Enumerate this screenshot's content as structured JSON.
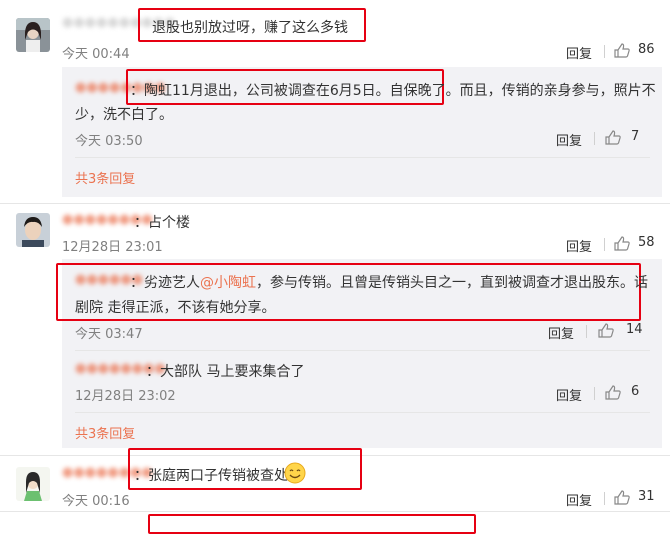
{
  "comments": [
    {
      "text": "退股也别放过呀，赚了这么多钱",
      "time": "今天 00:44",
      "reply_label": "回复",
      "likes": "86",
      "replies": [
        {
          "text": "：陶虹11月退出，公司被调查在6月5日。自保晚了。而且，传销的亲身参与，照片不少，洗不白了。",
          "line1": "：陶虹11月退出，公司被调查在6月5日。自保晚了。而且，传销的亲身参与，照片不",
          "line2": "少，洗不白了。",
          "time": "今天 03:50",
          "reply_label": "回复",
          "likes": "7"
        }
      ],
      "more_replies": "共3条回复"
    },
    {
      "text": "：占个楼",
      "time": "12月28日 23:01",
      "reply_label": "回复",
      "likes": "58",
      "replies": [
        {
          "pre": "：劣迹艺人",
          "mention": "@小陶虹",
          "post": "，参与传销。且曾是传销头目之一，直到被调查才退出股东。话",
          "line2": "剧院 走得正派，不该有她分享。",
          "time": "今天 03:47",
          "reply_label": "回复",
          "likes": "14"
        },
        {
          "text": "：大部队 马上要来集合了",
          "time": "12月28日 23:02",
          "reply_label": "回复",
          "likes": "6"
        }
      ],
      "more_replies": "共3条回复"
    },
    {
      "text": "：张庭两口子传销被查处啦",
      "time": "今天 00:16",
      "reply_label": "回复",
      "likes": "31"
    }
  ],
  "colors": {
    "highlight": "#e60012",
    "link": "#eb7350",
    "reply_bg": "#f2f2f5"
  },
  "icons": [
    "avatar",
    "thumbs-up-icon",
    "smiley-emoji-icon"
  ]
}
